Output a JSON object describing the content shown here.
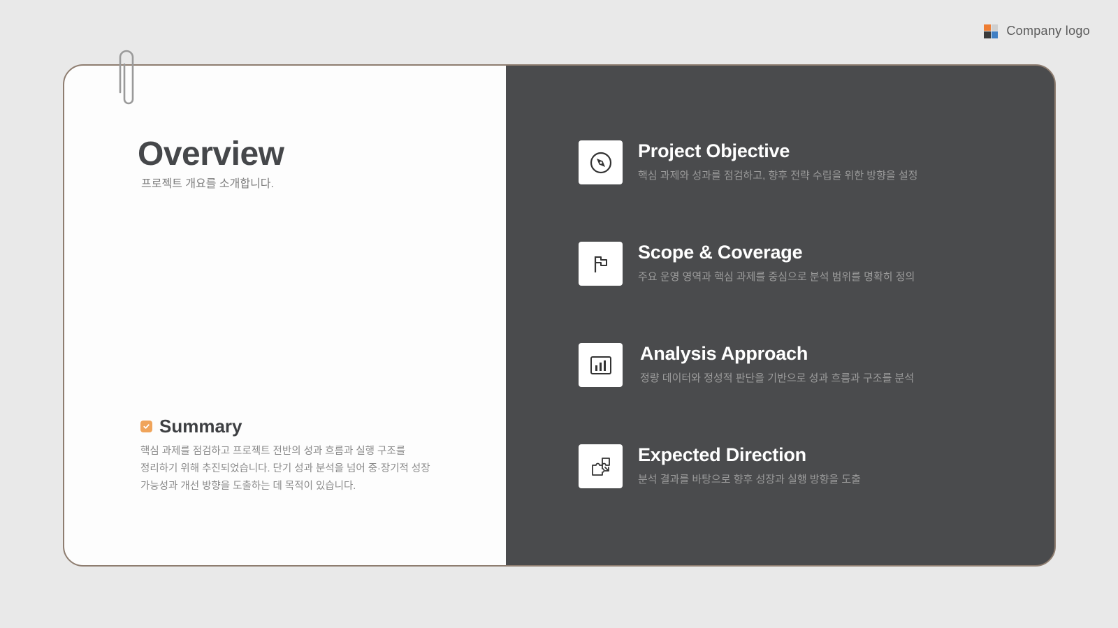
{
  "logo": {
    "text": "Company logo",
    "colors": [
      "#ee7d33",
      "#3f7fc4",
      "#3a3a3a",
      "#cfcfcf"
    ]
  },
  "overview": {
    "title": "Overview",
    "subtitle": "프로젝트 개요를 소개합니다."
  },
  "summary": {
    "icon": "check-badge-icon",
    "title": "Summary",
    "lines": [
      "핵심 과제를 점검하고 프로젝트 전반의 성과 흐름과 실행 구조를",
      "정리하기 위해 추진되었습니다. 단기 성과 분석을 넘어 중·장기적 성장",
      "가능성과 개선 방향을 도출하는 데 목적이 있습니다."
    ]
  },
  "items": [
    {
      "icon": "compass-icon",
      "title": "Project Objective",
      "desc": "핵심 과제와 성과를 점검하고, 향후 전략 수립을 위한 방향을 설정"
    },
    {
      "icon": "flag-icon",
      "title": "Scope & Coverage",
      "desc": "주요 운영 영역과 핵심 과제를 중심으로 분석 범위를 명확히 정의"
    },
    {
      "icon": "bar-chart-icon",
      "title": "Analysis Approach",
      "desc": "정량 데이터와 정성적 판단을 기반으로 성과 흐름과 구조를 분석"
    },
    {
      "icon": "puzzle-icon",
      "title": "Expected Direction",
      "desc": "분석 결과를 바탕으로 향후 성장과 실행 방향을 도출"
    }
  ],
  "colors": {
    "background": "#e9e9e9",
    "panel_light": "#fdfdfd",
    "panel_dark": "#4a4b4d",
    "accent": "#f0a45a",
    "border": "#8e7d70"
  }
}
